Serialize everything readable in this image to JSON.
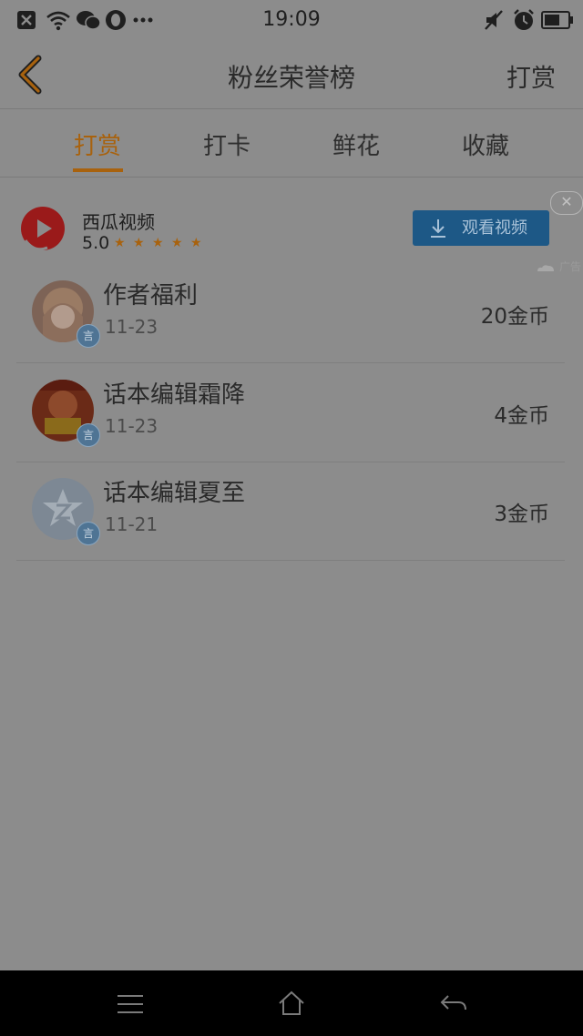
{
  "status_bar": {
    "time": "19:09"
  },
  "header": {
    "title": "粉丝荣誉榜",
    "action": "打赏"
  },
  "tabs": [
    {
      "label": "打赏",
      "active": true
    },
    {
      "label": "打卡",
      "active": false
    },
    {
      "label": "鲜花",
      "active": false
    },
    {
      "label": "收藏",
      "active": false
    }
  ],
  "ad": {
    "app_name": "西瓜视频",
    "rating": "5.0",
    "stars": 5,
    "button_label": "观看视频",
    "close": "✕",
    "label": "广告"
  },
  "list": [
    {
      "name": "作者福利",
      "date": "11-23",
      "amount": "20金币"
    },
    {
      "name": "话本编辑霜降",
      "date": "11-23",
      "amount": "4金币"
    },
    {
      "name": "话本编辑夏至",
      "date": "11-21",
      "amount": "3金币"
    }
  ],
  "badge_text": "言",
  "colors": {
    "accent": "#a8620e",
    "overlay": "#8c8c8c",
    "ad_button": "#1d5886"
  }
}
